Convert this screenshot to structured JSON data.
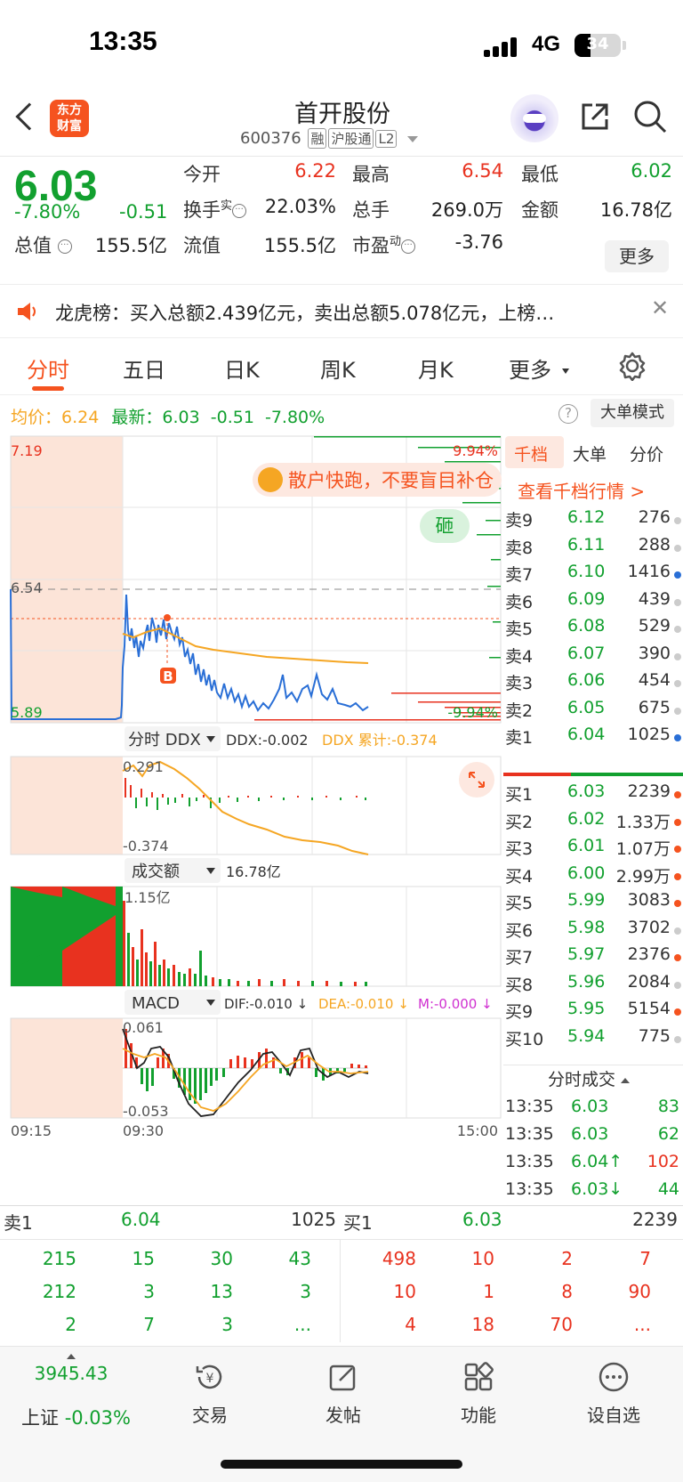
{
  "status": {
    "time": "13:35",
    "network": "4G",
    "battery": "34"
  },
  "header": {
    "logo_line1": "东方",
    "logo_line2": "财富",
    "stock_name": "首开股份",
    "code": "600376",
    "tags": [
      "融",
      "沪股通",
      "L2"
    ]
  },
  "quote": {
    "price": "6.03",
    "change_pct": "-7.80%",
    "change": "-0.51",
    "open_label": "今开",
    "open": "6.22",
    "high_label": "最高",
    "high": "6.54",
    "low_label": "最低",
    "low": "6.02",
    "turnover_label": "换手",
    "turnover_sup": "实",
    "turnover": "22.03%",
    "volume_label": "总手",
    "volume": "269.0万",
    "amount_label": "金额",
    "amount": "16.78亿",
    "mcap_label": "总值",
    "mcap": "155.5亿",
    "float_label": "流值",
    "float": "155.5亿",
    "pe_label": "市盈",
    "pe_sup": "动",
    "pe": "-3.76",
    "more_label": "更多"
  },
  "notice": {
    "text": "龙虎榜：买入总额2.439亿元，卖出总额5.078亿元，上榜…"
  },
  "tabs": {
    "items": [
      "分时",
      "五日",
      "日K",
      "周K",
      "月K",
      "更多"
    ]
  },
  "chart_info": {
    "avg_label": "均价：",
    "avg": "6.24",
    "latest_label": "最新：",
    "latest": "6.03",
    "chg": "-0.51",
    "pct": "-7.80%",
    "mode_btn": "大单模式"
  },
  "chart_labels": {
    "price_top": "7.19",
    "price_bottom": "5.89",
    "pct_top": "9.94%",
    "pct_bottom": "-9.94%",
    "high_line": "6.54",
    "banner": "散户快跑，不要盲目补仓",
    "smash": "砸",
    "marker": "B",
    "ddx_sel": "分时 DDX",
    "ddx_val": "DDX:-0.002",
    "ddx_cum": "DDX 累计:-0.374",
    "ddx_top": "0.291",
    "ddx_bot": "-0.374",
    "amt_sel": "成交额",
    "amt_val": "16.78亿",
    "amt_top": "1.15亿",
    "macd_sel": "MACD",
    "dif": "DIF:-0.010 ↓",
    "dea": "DEA:-0.010 ↓",
    "m": "M:-0.000 ↓",
    "macd_top": "0.061",
    "macd_bot": "-0.053",
    "t_start": "09:15",
    "t_open": "09:30",
    "t_end": "15:00"
  },
  "orderbook": {
    "tabs": [
      "千档",
      "大单",
      "分价"
    ],
    "link": "查看千档行情 >",
    "asks": [
      {
        "l": "卖9",
        "p": "6.12",
        "v": "276",
        "c": "#ccc"
      },
      {
        "l": "卖8",
        "p": "6.11",
        "v": "288",
        "c": "#ccc"
      },
      {
        "l": "卖7",
        "p": "6.10",
        "v": "1416",
        "c": "#2a6fd6"
      },
      {
        "l": "卖6",
        "p": "6.09",
        "v": "439",
        "c": "#ccc"
      },
      {
        "l": "卖5",
        "p": "6.08",
        "v": "529",
        "c": "#ccc"
      },
      {
        "l": "卖4",
        "p": "6.07",
        "v": "390",
        "c": "#ccc"
      },
      {
        "l": "卖3",
        "p": "6.06",
        "v": "454",
        "c": "#ccc"
      },
      {
        "l": "卖2",
        "p": "6.05",
        "v": "675",
        "c": "#ccc"
      },
      {
        "l": "卖1",
        "p": "6.04",
        "v": "1025",
        "c": "#2a6fd6"
      }
    ],
    "bids": [
      {
        "l": "买1",
        "p": "6.03",
        "v": "2239",
        "c": "#f5531f"
      },
      {
        "l": "买2",
        "p": "6.02",
        "v": "1.33万",
        "c": "#f5531f"
      },
      {
        "l": "买3",
        "p": "6.01",
        "v": "1.07万",
        "c": "#f5531f"
      },
      {
        "l": "买4",
        "p": "6.00",
        "v": "2.99万",
        "c": "#f5531f"
      },
      {
        "l": "买5",
        "p": "5.99",
        "v": "3083",
        "c": "#f5531f"
      },
      {
        "l": "买6",
        "p": "5.98",
        "v": "3702",
        "c": "#ccc"
      },
      {
        "l": "买7",
        "p": "5.97",
        "v": "2376",
        "c": "#f5531f"
      },
      {
        "l": "买8",
        "p": "5.96",
        "v": "2084",
        "c": "#ccc"
      },
      {
        "l": "买9",
        "p": "5.95",
        "v": "5154",
        "c": "#f5531f"
      },
      {
        "l": "买10",
        "p": "5.94",
        "v": "775",
        "c": "#ccc"
      }
    ],
    "ticks_title": "分时成交",
    "ticks": [
      {
        "t": "13:35",
        "p": "6.03",
        "v": "83",
        "vc": "#12a02f"
      },
      {
        "t": "13:35",
        "p": "6.03",
        "v": "62",
        "vc": "#12a02f"
      },
      {
        "t": "13:35",
        "p": "6.04↑",
        "v": "102",
        "vc": "#e8321f"
      },
      {
        "t": "13:35",
        "p": "6.03↓",
        "v": "44",
        "vc": "#12a02f"
      }
    ]
  },
  "bottom_quote": {
    "sell_label": "卖1",
    "sell_price": "6.04",
    "sell_vol": "1025",
    "buy_label": "买1",
    "buy_price": "6.03",
    "buy_vol": "2239",
    "sell_rows": [
      [
        "215",
        "15",
        "30",
        "43"
      ],
      [
        "212",
        "3",
        "13",
        "3"
      ],
      [
        "2",
        "7",
        "3",
        "..."
      ]
    ],
    "buy_rows": [
      [
        "498",
        "10",
        "2",
        "7"
      ],
      [
        "10",
        "1",
        "8",
        "90"
      ],
      [
        "4",
        "18",
        "70",
        "..."
      ]
    ]
  },
  "nav": {
    "index_value": "3945.43",
    "index_label": "上证 -0.03%",
    "trade": "交易",
    "post": "发帖",
    "func": "功能",
    "watch": "设自选"
  }
}
